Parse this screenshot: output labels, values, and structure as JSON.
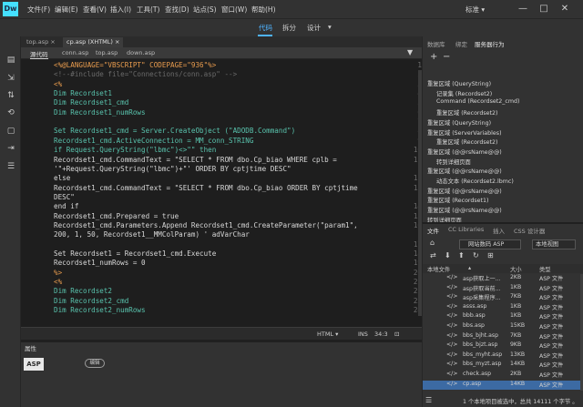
{
  "app": {
    "logo": "Dw"
  },
  "menu": [
    "文件(F)",
    "编辑(E)",
    "查看(V)",
    "插入(I)",
    "工具(T)",
    "查找(D)",
    "站点(S)",
    "窗口(W)",
    "帮助(H)"
  ],
  "workspace": "标准 ▾",
  "window_controls": [
    "—",
    "□",
    "✕"
  ],
  "view_modes": {
    "code": "代码",
    "split": "拆分",
    "design": "设计",
    "dropdown": "▾"
  },
  "doc_tabs": [
    "top.asp ×",
    "cp.asp (XHTML) ×"
  ],
  "related_files": [
    "源代码",
    "conn.asp",
    "top.asp",
    "down.asp"
  ],
  "code_lines": [
    {
      "n": "1",
      "t": [
        [
          "asp",
          "<%@LANGUAGE=\"VBSCRIPT\" CODEPAGE=\"936\"%>"
        ]
      ]
    },
    {
      "n": "2",
      "t": [
        [
          "com",
          "<!--#include file=\"Connections/conn.asp\" -->"
        ]
      ]
    },
    {
      "n": "3",
      "t": [
        [
          "asp",
          "<%"
        ]
      ]
    },
    {
      "n": "4",
      "t": [
        [
          "vb",
          "Dim Recordset1"
        ]
      ]
    },
    {
      "n": "5",
      "t": [
        [
          "vb",
          "Dim Recordset1_cmd"
        ]
      ]
    },
    {
      "n": "6",
      "t": [
        [
          "vb",
          "Dim Recordset1_numRows"
        ]
      ]
    },
    {
      "n": "7",
      "t": [
        [
          "plain",
          ""
        ]
      ]
    },
    {
      "n": "8",
      "t": [
        [
          "vb",
          "Set Recordset1_cmd = Server.CreateObject (\"ADODB.Command\")"
        ]
      ]
    },
    {
      "n": "9",
      "t": [
        [
          "vb",
          "Recordset1_cmd.ActiveConnection = MM_conn_STRING"
        ]
      ]
    },
    {
      "n": "10",
      "t": [
        [
          "vb",
          "if Request.QueryString(\"lbmc\")<>\"\" then"
        ]
      ]
    },
    {
      "n": "11",
      "t": [
        [
          "plain",
          "Recordset1_cmd.CommandText = \"SELECT * FROM dbo.Cp_biao WHERE cplb ="
        ]
      ]
    },
    {
      "n": "",
      "t": [
        [
          "plain",
          "'\"+Request.QueryString(\"lbmc\")+\"' ORDER BY cptjtime DESC\""
        ]
      ]
    },
    {
      "n": "12",
      "t": [
        [
          "plain",
          "else"
        ]
      ]
    },
    {
      "n": "13",
      "t": [
        [
          "plain",
          "Recordset1_cmd.CommandText = \"SELECT * FROM dbo.Cp_biao ORDER BY cptjtime"
        ]
      ]
    },
    {
      "n": "",
      "t": [
        [
          "plain",
          "DESC\""
        ]
      ]
    },
    {
      "n": "14",
      "t": [
        [
          "plain",
          "end if"
        ]
      ]
    },
    {
      "n": "15",
      "t": [
        [
          "plain",
          "Recordset1_cmd.Prepared = true"
        ]
      ]
    },
    {
      "n": "16",
      "t": [
        [
          "plain",
          "Recordset1_cmd.Parameters.Append Recordset1_cmd.CreateParameter(\"param1\","
        ]
      ]
    },
    {
      "n": "",
      "t": [
        [
          "plain",
          "200, 1, 50, Recordset1__MMColParam) ' adVarChar"
        ]
      ]
    },
    {
      "n": "17",
      "t": [
        [
          "plain",
          ""
        ]
      ]
    },
    {
      "n": "18",
      "t": [
        [
          "plain",
          "Set Recordset1 = Recordset1_cmd.Execute"
        ]
      ]
    },
    {
      "n": "19",
      "t": [
        [
          "plain",
          "Recordset1_numRows = 0"
        ]
      ]
    },
    {
      "n": "20",
      "t": [
        [
          "asp",
          "%>"
        ]
      ]
    },
    {
      "n": "21",
      "t": [
        [
          "asp",
          "<%"
        ]
      ]
    },
    {
      "n": "22",
      "t": [
        [
          "vb",
          "Dim Recordset2"
        ]
      ]
    },
    {
      "n": "23",
      "t": [
        [
          "vb",
          "Dim Recordset2_cmd"
        ]
      ]
    },
    {
      "n": "24",
      "t": [
        [
          "vb",
          "Dim Recordset2_numRows"
        ]
      ]
    }
  ],
  "status": {
    "doc_type": "HTML ▾",
    "insert_mode": "INS",
    "position": "34:3",
    "icon": "⊡"
  },
  "properties": {
    "title": "属性",
    "badge": "ASP",
    "edit_button": "编辑"
  },
  "panel_top": {
    "tabs": [
      "数据库",
      "绑定",
      "服务器行为"
    ],
    "toolbar": [
      "+",
      "−"
    ],
    "bindings": [
      {
        "label": "重复区域 (QueryString)",
        "indent": 0
      },
      {
        "label": "记录集 (Recordset2)",
        "indent": 1
      },
      {
        "label": "Command (Recordset2_cmd)",
        "indent": 1
      },
      {
        "label": "重复区域 (Recordset2)",
        "indent": 1
      },
      {
        "label": "重复区域 (QueryString)",
        "indent": 0
      },
      {
        "label": "重复区域 (ServerVariables)",
        "indent": 0
      },
      {
        "label": "重复区域 (Recordset2)",
        "indent": 1
      },
      {
        "label": "重复区域 (@@rsName@@)",
        "indent": 0
      },
      {
        "label": "转到详细页面",
        "indent": 1
      },
      {
        "label": "重复区域 (@@rsName@@)",
        "indent": 0
      },
      {
        "label": "动态文本 (Recordset2.lbmc)",
        "indent": 1
      },
      {
        "label": "重复区域 (@@rsName@@)",
        "indent": 0
      },
      {
        "label": "重复区域 (Recordset1)",
        "indent": 0
      },
      {
        "label": "重复区域 (@@rsName@@)",
        "indent": 0
      },
      {
        "label": "转到详细页面",
        "indent": 0
      }
    ]
  },
  "files_panel": {
    "tabs": [
      "文件",
      "CC Libraries",
      "插入",
      "CSS 设计器"
    ],
    "site": "网站数码 ASP",
    "view": "本地视图",
    "tool_icons": [
      "⇄",
      "⬇",
      "⬆",
      "↻",
      "⊞"
    ],
    "columns": [
      "本地文件",
      "大小",
      "类型"
    ],
    "sort_icon": "▴",
    "rows": [
      {
        "icon": "</>",
        "name": "asp获取上一...",
        "size": "2KB",
        "type": "ASP 文件"
      },
      {
        "icon": "</>",
        "name": "asp获取当前...",
        "size": "1KB",
        "type": "ASP 文件"
      },
      {
        "icon": "</>",
        "name": "asp采集程序...",
        "size": "7KB",
        "type": "ASP 文件"
      },
      {
        "icon": "</>",
        "name": "asss.asp",
        "size": "1KB",
        "type": "ASP 文件"
      },
      {
        "icon": "</>",
        "name": "bbb.asp",
        "size": "1KB",
        "type": "ASP 文件"
      },
      {
        "icon": "</>",
        "name": "bbs.asp",
        "size": "15KB",
        "type": "ASP 文件"
      },
      {
        "icon": "</>",
        "name": "bbs_bjht.asp",
        "size": "7KB",
        "type": "ASP 文件"
      },
      {
        "icon": "</>",
        "name": "bbs_bjzt.asp",
        "size": "9KB",
        "type": "ASP 文件"
      },
      {
        "icon": "</>",
        "name": "bbs_myht.asp",
        "size": "13KB",
        "type": "ASP 文件"
      },
      {
        "icon": "</>",
        "name": "bbs_myzt.asp",
        "size": "14KB",
        "type": "ASP 文件"
      },
      {
        "icon": "</>",
        "name": "check.asp",
        "size": "2KB",
        "type": "ASP 文件"
      },
      {
        "icon": "</>",
        "name": "cp.asp",
        "size": "14KB",
        "type": "ASP 文件"
      }
    ],
    "status": "1 个本地项目被选中，总共 14111 个字节 。"
  }
}
